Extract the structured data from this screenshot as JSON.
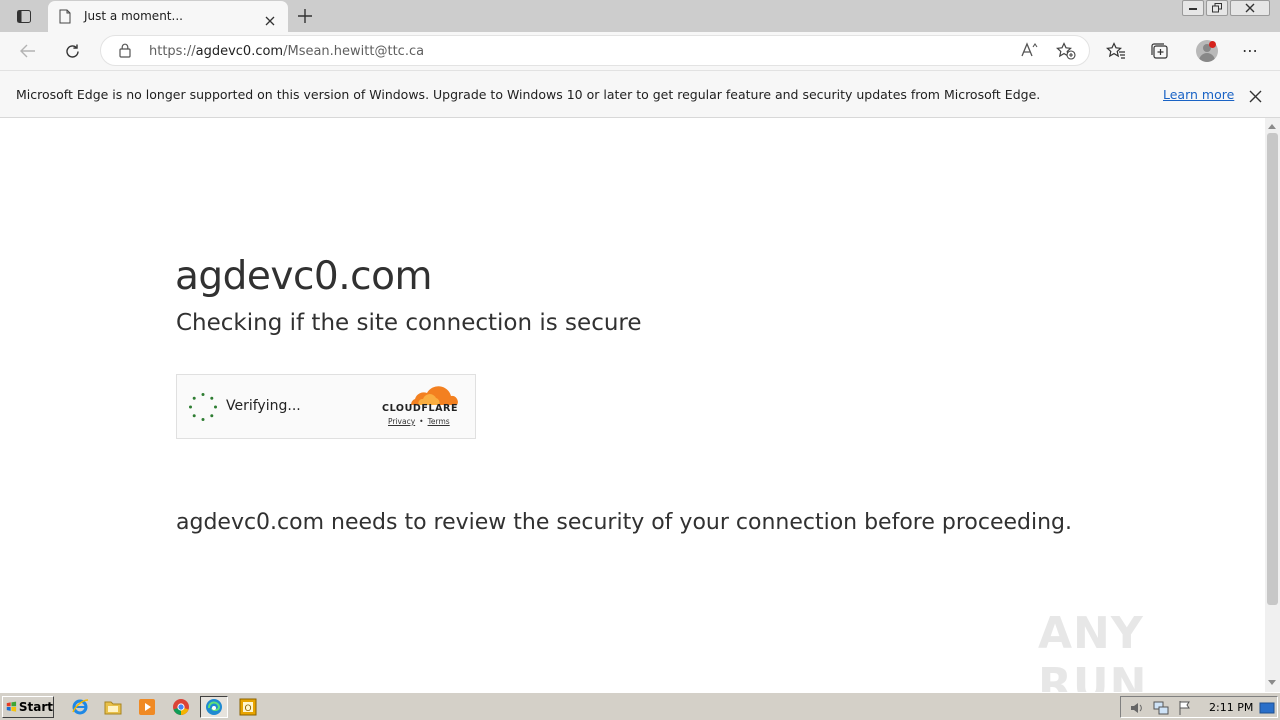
{
  "browser": {
    "tab": {
      "title": "Just a moment...",
      "favicon": "page-icon"
    },
    "address": {
      "url_prefix": "https://",
      "url_host": "agdevc0.com",
      "url_path": "/Msean.hewitt@ttc.ca",
      "read_aloud_label": "Aᴬ"
    },
    "infobar": {
      "message": "Microsoft Edge is no longer supported on this version of Windows. Upgrade to Windows 10 or later to get regular feature and security updates from Microsoft Edge.",
      "learn_more": "Learn more"
    }
  },
  "page": {
    "site_title": "agdevc0.com",
    "subtitle": "Checking if the site connection is secure",
    "widget": {
      "status": "Verifying...",
      "brand": "CLOUDFLARE",
      "privacy": "Privacy",
      "separator": "•",
      "terms": "Terms"
    },
    "review_text": "agdevc0.com needs to review the security of your connection before proceeding."
  },
  "watermark": "ANY RUN",
  "taskbar": {
    "start_label": "Start",
    "clock": "2:11 PM",
    "apps": [
      "ie-icon",
      "explorer-icon",
      "media-player-icon",
      "chrome-icon",
      "edge-icon",
      "outlook-icon"
    ]
  },
  "colors": {
    "cloudflare_orange": "#f38020",
    "spinner_green": "#2e7d32",
    "link_blue": "#1a63c5"
  }
}
